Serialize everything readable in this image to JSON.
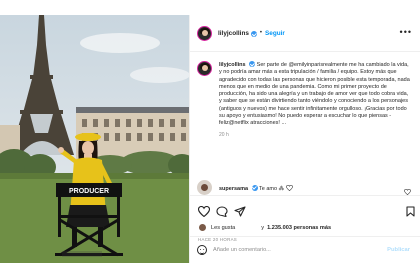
{
  "header": {
    "username": "lilyjcollins",
    "separator": "•",
    "follow_label": "Seguir",
    "more_label": "•••"
  },
  "caption": {
    "username": "lilyjcollins",
    "text": "Ser parte de @emilyinparisrealmente me ha cambiado la vida, y no podría amar más a esta tripulación / familia / equipo. Estoy más que agradecido con todas las personas que hicieron posible esta temporada, nada menos que en medio de una pandemia. Como mi primer proyecto de producción, ha sido una alegría y un trabajo de amor ver que todo cobra vida, y saber que se están divirtiendo tanto viéndolo y conociendo a los personajes (antiguos y nuevos) me hace sentir infinitamente orgulloso. ¡Gracias por todo su apoyo y entusiasmo! No puedo esperar a escuchar lo que piensas - feliz@netflix atracciones! ...",
    "time": "20 h"
  },
  "comment": {
    "username": "supersama",
    "text": "Te amo",
    "emoji": "⁂"
  },
  "likes": {
    "prefix": "Les gusta",
    "middle": "y",
    "count": "1.235.003 personas más"
  },
  "timestamp": "HACE 20 HORAS",
  "add_comment": {
    "placeholder": "Añade un comentario...",
    "publish_label": "Publicar"
  },
  "photo": {
    "chair_text": "PRODUCER"
  },
  "colors": {
    "accent_blue": "#0095f6",
    "verified_blue": "#3897f0",
    "publish_disabled": "#b2dffc",
    "muted": "#8e8e8e"
  },
  "icons": [
    "more-icon",
    "verified-icon",
    "heart-icon",
    "comment-icon",
    "share-icon",
    "bookmark-icon",
    "emoji-icon"
  ]
}
